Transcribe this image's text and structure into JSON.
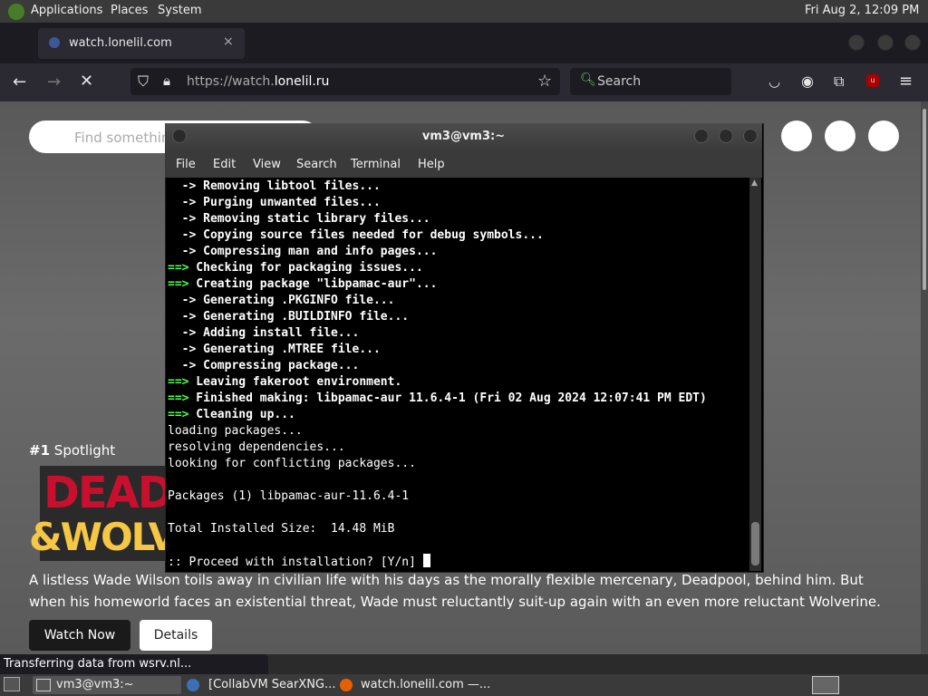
{
  "panel": {
    "menus": [
      "Applications",
      "Places",
      "System"
    ],
    "clock": "Fri Aug  2, 12:09 PM"
  },
  "browser": {
    "tab_title": "watch.lonelil.com",
    "tab_close": "×",
    "url_prefix": "https://watch.",
    "url_domain": "lonelil.ru",
    "search_placeholder": "Search",
    "find_placeholder": "Find somethin",
    "transfer_status": "Transferring data from wsrv.nl..."
  },
  "page": {
    "spotlight_rank": "#1",
    "spotlight_label": "Spotlight",
    "poster_line1": "DEAD",
    "poster_line2": "&WOLV",
    "description": "A listless Wade Wilson toils away in civilian life with his days as the morally flexible mercenary, Deadpool, behind him. But when his homeworld faces an existential threat, Wade must reluctantly suit-up again with an even more reluctant Wolverine.",
    "watch_now": "Watch Now",
    "details": "Details"
  },
  "terminal": {
    "title": "vm3@vm3:~",
    "menu": [
      "File",
      "Edit",
      "View",
      "Search",
      "Terminal",
      "Help"
    ],
    "lines": [
      {
        "prefix": "  ->",
        "text": " Removing libtool files...",
        "style": "sub"
      },
      {
        "prefix": "  ->",
        "text": " Purging unwanted files...",
        "style": "sub"
      },
      {
        "prefix": "  ->",
        "text": " Removing static library files...",
        "style": "sub"
      },
      {
        "prefix": "  ->",
        "text": " Copying source files needed for debug symbols...",
        "style": "sub"
      },
      {
        "prefix": "  ->",
        "text": " Compressing man and info pages...",
        "style": "sub"
      },
      {
        "prefix": "==>",
        "text": " Checking for packaging issues...",
        "style": "main"
      },
      {
        "prefix": "==>",
        "text": " Creating package \"libpamac-aur\"...",
        "style": "main"
      },
      {
        "prefix": "  ->",
        "text": " Generating .PKGINFO file...",
        "style": "sub"
      },
      {
        "prefix": "  ->",
        "text": " Generating .BUILDINFO file...",
        "style": "sub"
      },
      {
        "prefix": "  ->",
        "text": " Adding install file...",
        "style": "sub"
      },
      {
        "prefix": "  ->",
        "text": " Generating .MTREE file...",
        "style": "sub"
      },
      {
        "prefix": "  ->",
        "text": " Compressing package...",
        "style": "sub"
      },
      {
        "prefix": "==>",
        "text": " Leaving fakeroot environment.",
        "style": "main"
      },
      {
        "prefix": "==>",
        "text": " Finished making: libpamac-aur 11.6.4-1 (Fri 02 Aug 2024 12:07:41 PM EDT)",
        "style": "main"
      },
      {
        "prefix": "==>",
        "text": " Cleaning up...",
        "style": "main"
      },
      {
        "prefix": "",
        "text": "loading packages...",
        "style": "plain"
      },
      {
        "prefix": "",
        "text": "resolving dependencies...",
        "style": "plain"
      },
      {
        "prefix": "",
        "text": "looking for conflicting packages...",
        "style": "plain"
      },
      {
        "prefix": "",
        "text": "",
        "style": "plain"
      },
      {
        "prefix": "",
        "text": "Packages (1) libpamac-aur-11.6.4-1",
        "style": "plain"
      },
      {
        "prefix": "",
        "text": "",
        "style": "plain"
      },
      {
        "prefix": "",
        "text": "Total Installed Size:  14.48 MiB",
        "style": "plain"
      },
      {
        "prefix": "",
        "text": "",
        "style": "plain"
      },
      {
        "prefix": "",
        "text": ":: Proceed with installation? [Y/n] ",
        "style": "prompt"
      }
    ]
  },
  "taskbar": {
    "tasks": [
      "vm3@vm3:~",
      "[CollabVM SearXNG...",
      "watch.lonelil.com —..."
    ]
  },
  "colors": {
    "terminal_green": "#55ff55",
    "panel_bg": "#3a3a3a",
    "browser_bg": "#2b2a33"
  }
}
